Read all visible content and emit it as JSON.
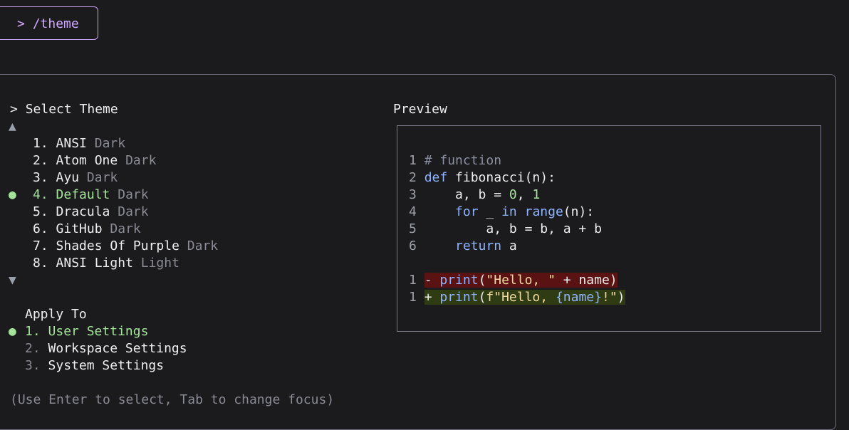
{
  "command": {
    "prompt": ">",
    "text": "/theme"
  },
  "select_theme": {
    "header_marker": ">",
    "header": "Select Theme",
    "scroll_up": "▲",
    "scroll_down": "▼",
    "selected_marker": "●",
    "items": [
      {
        "num": "1.",
        "name": "ANSI",
        "variant": "Dark",
        "selected": false
      },
      {
        "num": "2.",
        "name": "Atom One",
        "variant": "Dark",
        "selected": false
      },
      {
        "num": "3.",
        "name": "Ayu",
        "variant": "Dark",
        "selected": false
      },
      {
        "num": "4.",
        "name": "Default",
        "variant": "Dark",
        "selected": true
      },
      {
        "num": "5.",
        "name": "Dracula",
        "variant": "Dark",
        "selected": false
      },
      {
        "num": "6.",
        "name": "GitHub",
        "variant": "Dark",
        "selected": false
      },
      {
        "num": "7.",
        "name": "Shades Of Purple",
        "variant": "Dark",
        "selected": false
      },
      {
        "num": "8.",
        "name": "ANSI Light",
        "variant": "Light",
        "selected": false
      }
    ]
  },
  "apply_to": {
    "header": "Apply To",
    "selected_marker": "●",
    "items": [
      {
        "num": "1.",
        "label": "User Settings",
        "selected": true
      },
      {
        "num": "2.",
        "label": "Workspace Settings",
        "selected": false
      },
      {
        "num": "3.",
        "label": "System Settings",
        "selected": false
      }
    ]
  },
  "preview": {
    "title": "Preview",
    "code": {
      "l1_num": "1",
      "l1_comment": "# function",
      "l2_num": "2",
      "l2_kw": "def",
      "l2_rest": " fibonacci(n):",
      "l3_num": "3",
      "l3_a": "    a, b = ",
      "l3_n0": "0",
      "l3_sep": ", ",
      "l3_n1": "1",
      "l4_num": "4",
      "l4_indent": "    ",
      "l4_for": "for",
      "l4_mid": " _ ",
      "l4_in": "in",
      "l4_sp": " ",
      "l4_range": "range",
      "l4_rest": "(n):",
      "l5_num": "5",
      "l5_text": "        a, b = b, a + b",
      "l6_num": "6",
      "l6_indent": "    ",
      "l6_kw": "return",
      "l6_rest": " a"
    },
    "diff": {
      "d1_num": "1",
      "d1_a": "- ",
      "d1_fn": "print",
      "d1_b": "(",
      "d1_str": "\"Hello, \"",
      "d1_c": " + name)",
      "d2_num": "1",
      "d2_a": "+ ",
      "d2_fn": "print",
      "d2_b": "(",
      "d2_str1": "f\"Hello, ",
      "d2_var": "{name}",
      "d2_str2": "!\"",
      "d2_c": ")"
    }
  },
  "footer_hint": "(Use Enter to select, Tab to change focus)"
}
